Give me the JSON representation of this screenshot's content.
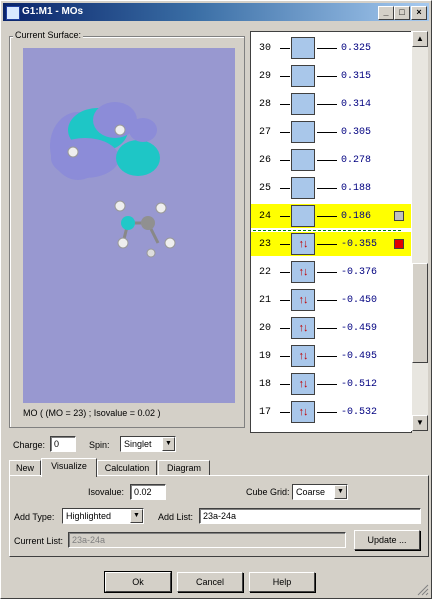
{
  "window": {
    "title": "G1:M1 - MOs",
    "minimize_icon": "minimize-icon",
    "maximize_icon": "maximize-icon",
    "close_icon": "close-icon"
  },
  "surface": {
    "group_label": "Current Surface:",
    "caption": "MO ( (MO = 23) ; Isovalue = 0.02 )",
    "colors": {
      "background": "#9898d0",
      "lobe_positive": "#20c8c8",
      "lobe_negative": "#8c8cd8"
    }
  },
  "orbitals": [
    {
      "n": "30",
      "energy": "0.325",
      "occ": "",
      "highlight": false,
      "marker": ""
    },
    {
      "n": "29",
      "energy": "0.315",
      "occ": "",
      "highlight": false,
      "marker": ""
    },
    {
      "n": "28",
      "energy": "0.314",
      "occ": "",
      "highlight": false,
      "marker": ""
    },
    {
      "n": "27",
      "energy": "0.305",
      "occ": "",
      "highlight": false,
      "marker": ""
    },
    {
      "n": "26",
      "energy": "0.278",
      "occ": "",
      "highlight": false,
      "marker": ""
    },
    {
      "n": "25",
      "energy": "0.188",
      "occ": "",
      "highlight": false,
      "marker": ""
    },
    {
      "n": "24",
      "energy": "0.186",
      "occ": "",
      "highlight": true,
      "marker": "#c0c0c0"
    },
    {
      "n": "23",
      "energy": "-0.355",
      "occ": "↑↓",
      "highlight": true,
      "marker": "#e00000"
    },
    {
      "n": "22",
      "energy": "-0.376",
      "occ": "↑↓",
      "highlight": false,
      "marker": ""
    },
    {
      "n": "21",
      "energy": "-0.450",
      "occ": "↑↓",
      "highlight": false,
      "marker": ""
    },
    {
      "n": "20",
      "energy": "-0.459",
      "occ": "↑↓",
      "highlight": false,
      "marker": ""
    },
    {
      "n": "19",
      "energy": "-0.495",
      "occ": "↑↓",
      "highlight": false,
      "marker": ""
    },
    {
      "n": "18",
      "energy": "-0.512",
      "occ": "↑↓",
      "highlight": false,
      "marker": ""
    },
    {
      "n": "17",
      "energy": "-0.532",
      "occ": "↑↓",
      "highlight": false,
      "marker": ""
    }
  ],
  "scroll": {
    "up_icon": "scroll-up-icon",
    "down_icon": "scroll-down-icon",
    "up_glyph": "▲",
    "down_glyph": "▼"
  },
  "charge": {
    "label": "Charge:",
    "value": "0"
  },
  "spin": {
    "label": "Spin:",
    "value": "Singlet"
  },
  "tabs": [
    "New",
    "Visualize",
    "Calculation",
    "Diagram"
  ],
  "active_tab": "Visualize",
  "visualize": {
    "isovalue_label": "Isovalue:",
    "isovalue": "0.02",
    "cube_grid_label": "Cube Grid:",
    "cube_grid": "Coarse",
    "add_type_label": "Add Type:",
    "add_type": "Highlighted",
    "add_list_label": "Add List:",
    "add_list": "23a-24a",
    "current_list_label": "Current List:",
    "current_list": "23a-24a",
    "update_label": "Update ..."
  },
  "buttons": {
    "ok": "Ok",
    "cancel": "Cancel",
    "help": "Help"
  },
  "combo_glyph": "▼"
}
